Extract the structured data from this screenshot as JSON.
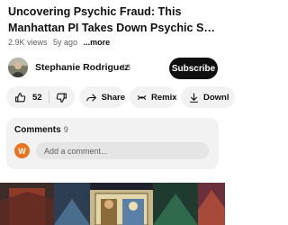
{
  "video": {
    "title_line1": "Uncovering Psychic Fraud: This",
    "title_line2": "Manhattan PI Takes Down Psychic Swin…",
    "views": "2.9K views",
    "age": "5y ago",
    "more": "...more"
  },
  "channel": {
    "name": "Stephanie Rodriguez",
    "subscribers": "18",
    "subscribe_label": "Subscribe"
  },
  "actions": {
    "like_count": "52",
    "share_label": "Share",
    "remix_label": "Remix",
    "download_label": "Downl"
  },
  "comments": {
    "title": "Comments",
    "count": "9",
    "avatar_letter": "W",
    "placeholder": "Add a comment..."
  },
  "colors": {
    "subscribe_bg": "#0f0f0f",
    "pill_bg": "#f2f2f2",
    "comment_avatar": "#e8741f"
  }
}
